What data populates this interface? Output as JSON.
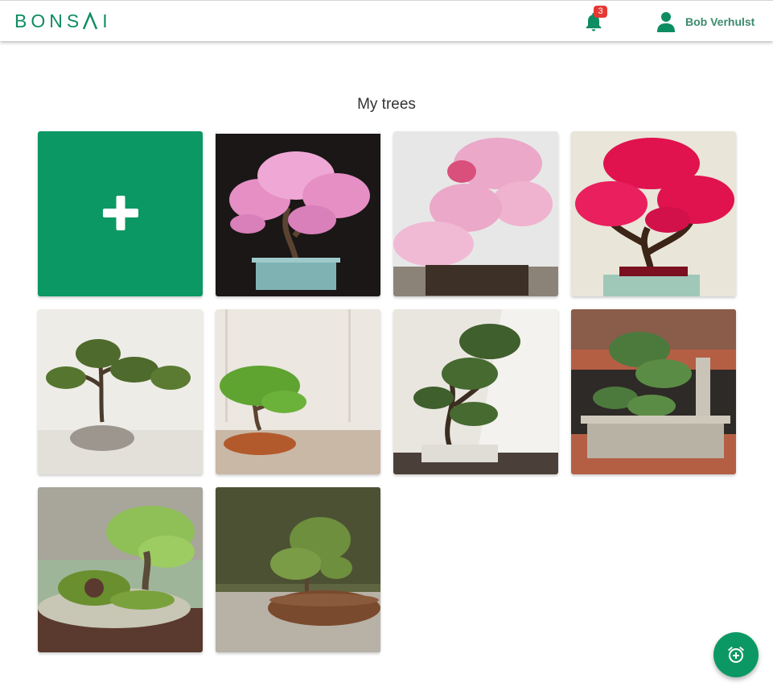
{
  "header": {
    "logo_text_part1": "BONS",
    "logo_text_part2": "I",
    "notification_count": "3",
    "user_name": "Bob Verhulst"
  },
  "main": {
    "title": "My trees",
    "add_tile_icon": "plus-icon",
    "trees": [
      {
        "name": "pink-mimosa-bonsai",
        "colors": {
          "bg": "#1a1716",
          "foliage": "#e58fc5",
          "pot": "#7fb3b3"
        }
      },
      {
        "name": "pink-azalea-bonsai",
        "colors": {
          "bg": "#e7e7e7",
          "foliage": "#eba8c8",
          "pot": "#3d3026"
        }
      },
      {
        "name": "red-maple-bonsai",
        "colors": {
          "bg": "#e9e5d9",
          "foliage": "#e0134f",
          "pot": "#9fc8b9"
        }
      },
      {
        "name": "pine-bonsai-stone-pot",
        "colors": {
          "bg": "#eeece7",
          "foliage": "#4e6a2c",
          "pot": "#9c968f"
        }
      },
      {
        "name": "juniper-bonsai-round-pot",
        "colors": {
          "bg": "#ece7e1",
          "foliage": "#5fa431",
          "pot": "#b35a2c"
        }
      },
      {
        "name": "cascade-bonsai-white-pot",
        "colors": {
          "bg": "#e9e6e0",
          "foliage": "#3f5f2c",
          "pot": "#e0ddd7"
        }
      },
      {
        "name": "temple-bonsai-stone-planter",
        "colors": {
          "bg": "#8a5c4a",
          "foliage": "#4c7a3c",
          "pot": "#b8b2a5"
        }
      },
      {
        "name": "hobbit-house-bonsai",
        "colors": {
          "bg": "#9fb59a",
          "foliage": "#8fbf57",
          "pot": "#c8c6b5"
        }
      },
      {
        "name": "small-bonsai-wooden-bowl",
        "colors": {
          "bg": "#5f6441",
          "foliage": "#6e8f3d",
          "pot": "#7a4a2e"
        }
      }
    ]
  },
  "fab": {
    "icon": "alarm-add-icon"
  },
  "colors": {
    "brand": "#0c9864",
    "badge": "#e53935"
  }
}
